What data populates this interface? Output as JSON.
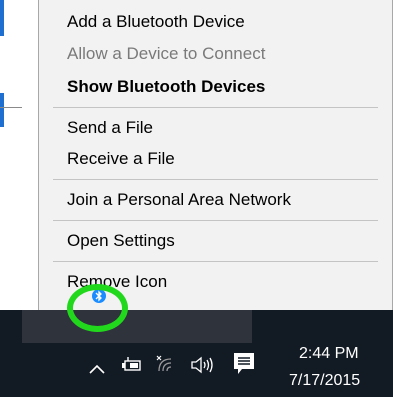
{
  "context_menu": {
    "items": [
      {
        "label": "Add a Bluetooth Device",
        "enabled": true,
        "bold": false
      },
      {
        "label": "Allow a Device to Connect",
        "enabled": false,
        "bold": false
      },
      {
        "label": "Show Bluetooth Devices",
        "enabled": true,
        "bold": true
      },
      {
        "label": "Send a File",
        "enabled": true,
        "bold": false
      },
      {
        "label": "Receive a File",
        "enabled": true,
        "bold": false
      },
      {
        "label": "Join a Personal Area Network",
        "enabled": true,
        "bold": false
      },
      {
        "label": "Open Settings",
        "enabled": true,
        "bold": false
      },
      {
        "label": "Remove Icon",
        "enabled": true,
        "bold": false
      }
    ]
  },
  "overflow_tray": {
    "icons": [
      "bluetooth-icon"
    ],
    "highlight_color": "#22d81c"
  },
  "taskbar": {
    "tray_icons": [
      "chevron-up-icon",
      "battery-icon",
      "wifi-icon",
      "volume-icon",
      "action-center-icon"
    ],
    "clock": {
      "time": "2:44 PM",
      "date": "7/17/2015"
    }
  },
  "colors": {
    "menu_background": "#f2f2f2",
    "taskbar_background": "#121a24",
    "accent": "#1a8cff"
  }
}
